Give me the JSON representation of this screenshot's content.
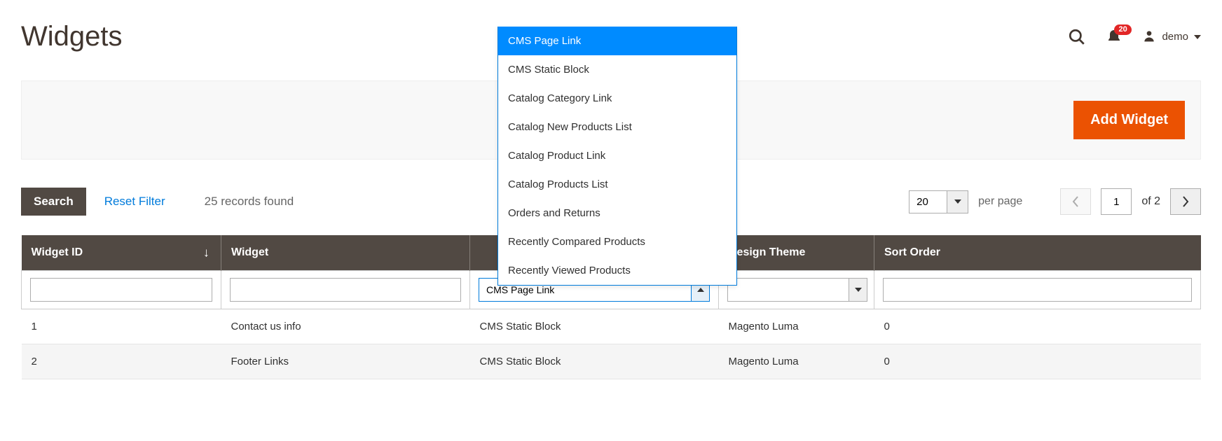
{
  "page": {
    "title": "Widgets",
    "user": "demo",
    "notif_count": "20"
  },
  "action_bar": {
    "add_label": "Add Widget"
  },
  "toolbar": {
    "search_label": "Search",
    "reset_label": "Reset Filter",
    "records_found": "25 records found",
    "per_page_value": "20",
    "per_page_label": "per page",
    "page_current": "1",
    "page_total": "of 2"
  },
  "columns": {
    "c1": "Widget ID",
    "c2": "Widget",
    "c3": "",
    "c4": "Design Theme",
    "c5": "Sort Order"
  },
  "filters": {
    "type_selected": "CMS Page Link"
  },
  "dropdown": {
    "items": [
      "CMS Page Link",
      "CMS Static Block",
      "Catalog Category Link",
      "Catalog New Products List",
      "Catalog Product Link",
      "Catalog Products List",
      "Orders and Returns",
      "Recently Compared Products",
      "Recently Viewed Products"
    ],
    "highlight_index": 0
  },
  "rows": [
    {
      "id": "1",
      "widget": "Contact us info",
      "type": "CMS Static Block",
      "theme": "Magento Luma",
      "sort": "0"
    },
    {
      "id": "2",
      "widget": "Footer Links",
      "type": "CMS Static Block",
      "theme": "Magento Luma",
      "sort": "0"
    }
  ]
}
